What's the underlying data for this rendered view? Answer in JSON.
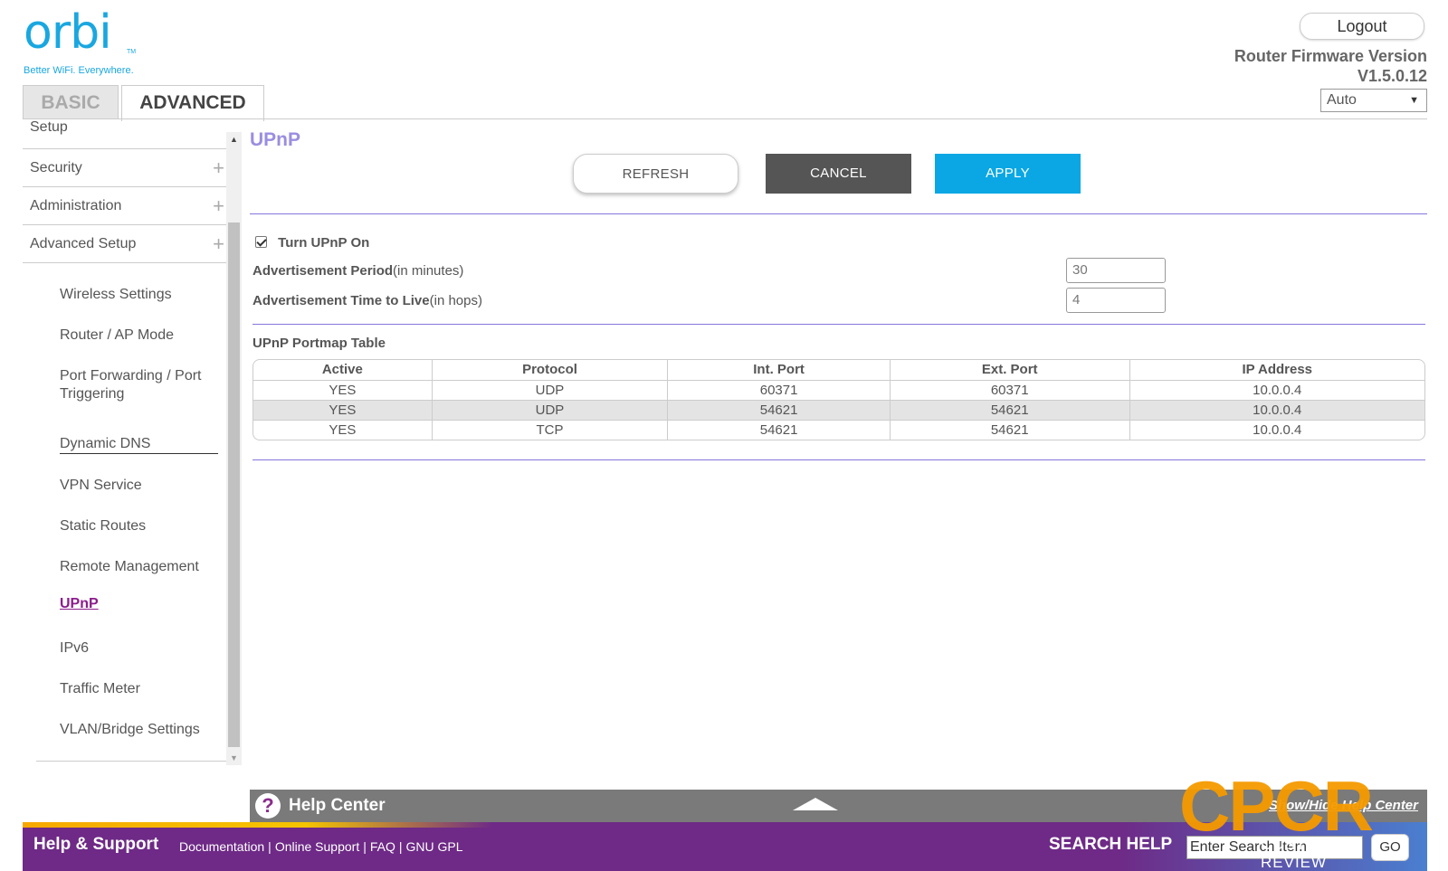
{
  "header": {
    "logo_text": "orbi",
    "logo_tm": "TM",
    "logo_tagline": "Better WiFi. Everywhere.",
    "logout_label": "Logout",
    "firmware_label": "Router Firmware Version",
    "firmware_version": "V1.5.0.12",
    "language_selected": "Auto",
    "tabs": [
      {
        "label": "BASIC",
        "active": false
      },
      {
        "label": "ADVANCED",
        "active": true
      }
    ]
  },
  "sidebar": {
    "partial_top": "Setup",
    "sections": [
      {
        "label": "Security",
        "icon": "plus-icon"
      },
      {
        "label": "Administration",
        "icon": "plus-icon"
      },
      {
        "label": "Advanced Setup",
        "icon": "plus-icon"
      }
    ],
    "subitems": [
      "Wireless Settings",
      "Router / AP Mode",
      "Port Forwarding / Port Triggering",
      "Dynamic DNS",
      "VPN Service",
      "Static Routes",
      "Remote Management",
      "UPnP",
      "IPv6",
      "Traffic Meter",
      "VLAN/Bridge Settings"
    ],
    "active_item": "UPnP"
  },
  "main": {
    "title": "UPnP",
    "buttons": {
      "refresh": "REFRESH",
      "cancel": "CANCEL",
      "apply": "APPLY"
    },
    "upnp_checkbox": {
      "label": "Turn UPnP On",
      "checked": true
    },
    "adv_period": {
      "label": "Advertisement Period",
      "unit": "(in minutes)",
      "value": "30"
    },
    "adv_ttl": {
      "label": "Advertisement Time to Live",
      "unit": "(in hops)",
      "value": "4"
    },
    "table_title": "UPnP Portmap Table",
    "table": {
      "columns": [
        "Active",
        "Protocol",
        "Int. Port",
        "Ext. Port",
        "IP Address"
      ],
      "rows": [
        [
          "YES",
          "UDP",
          "60371",
          "60371",
          "10.0.0.4"
        ],
        [
          "YES",
          "UDP",
          "54621",
          "54621",
          "10.0.0.4"
        ],
        [
          "YES",
          "TCP",
          "54621",
          "54621",
          "10.0.0.4"
        ]
      ]
    }
  },
  "help_center": {
    "icon": "question-icon",
    "title": "Help Center",
    "toggle_label": "Show/Hide Help Center"
  },
  "footer": {
    "title": "Help & Support",
    "links": [
      "Documentation",
      "Online Support",
      "FAQ",
      "GNU GPL"
    ],
    "search_label": "SEARCH HELP",
    "search_value": "Enter Search Item",
    "search_button": "GO"
  },
  "watermark": {
    "big": "CPCR",
    "small": "CUSTOM PC REVIEW"
  },
  "colors": {
    "accent_blue": "#0aa7e4",
    "title_purple": "#9a8ee0",
    "active_link": "#8b1c8b",
    "footer_purple": "#6e2a86",
    "watermark_orange": "#f59a00"
  }
}
